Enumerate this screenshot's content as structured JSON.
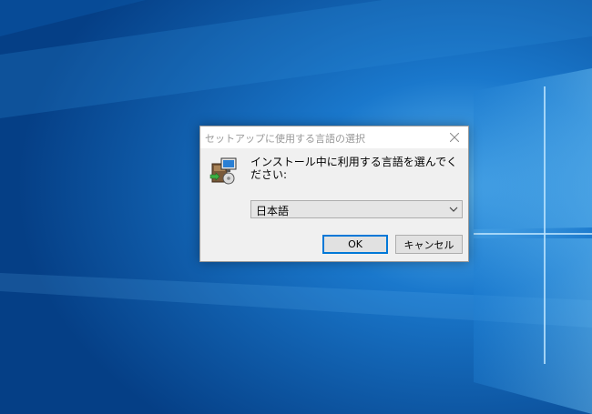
{
  "dialog": {
    "title": "セットアップに使用する言語の選択",
    "prompt": "インストール中に利用する言語を選んでください:",
    "selected_language": "日本語",
    "ok_label": "OK",
    "cancel_label": "キャンセル"
  },
  "icons": {
    "close": "close-icon",
    "app": "installer-icon",
    "dropdown": "chevron-down-icon"
  },
  "colors": {
    "desktop_blue": "#0a5cae",
    "accent": "#0078d7",
    "dialog_bg": "#f0f0f0"
  }
}
